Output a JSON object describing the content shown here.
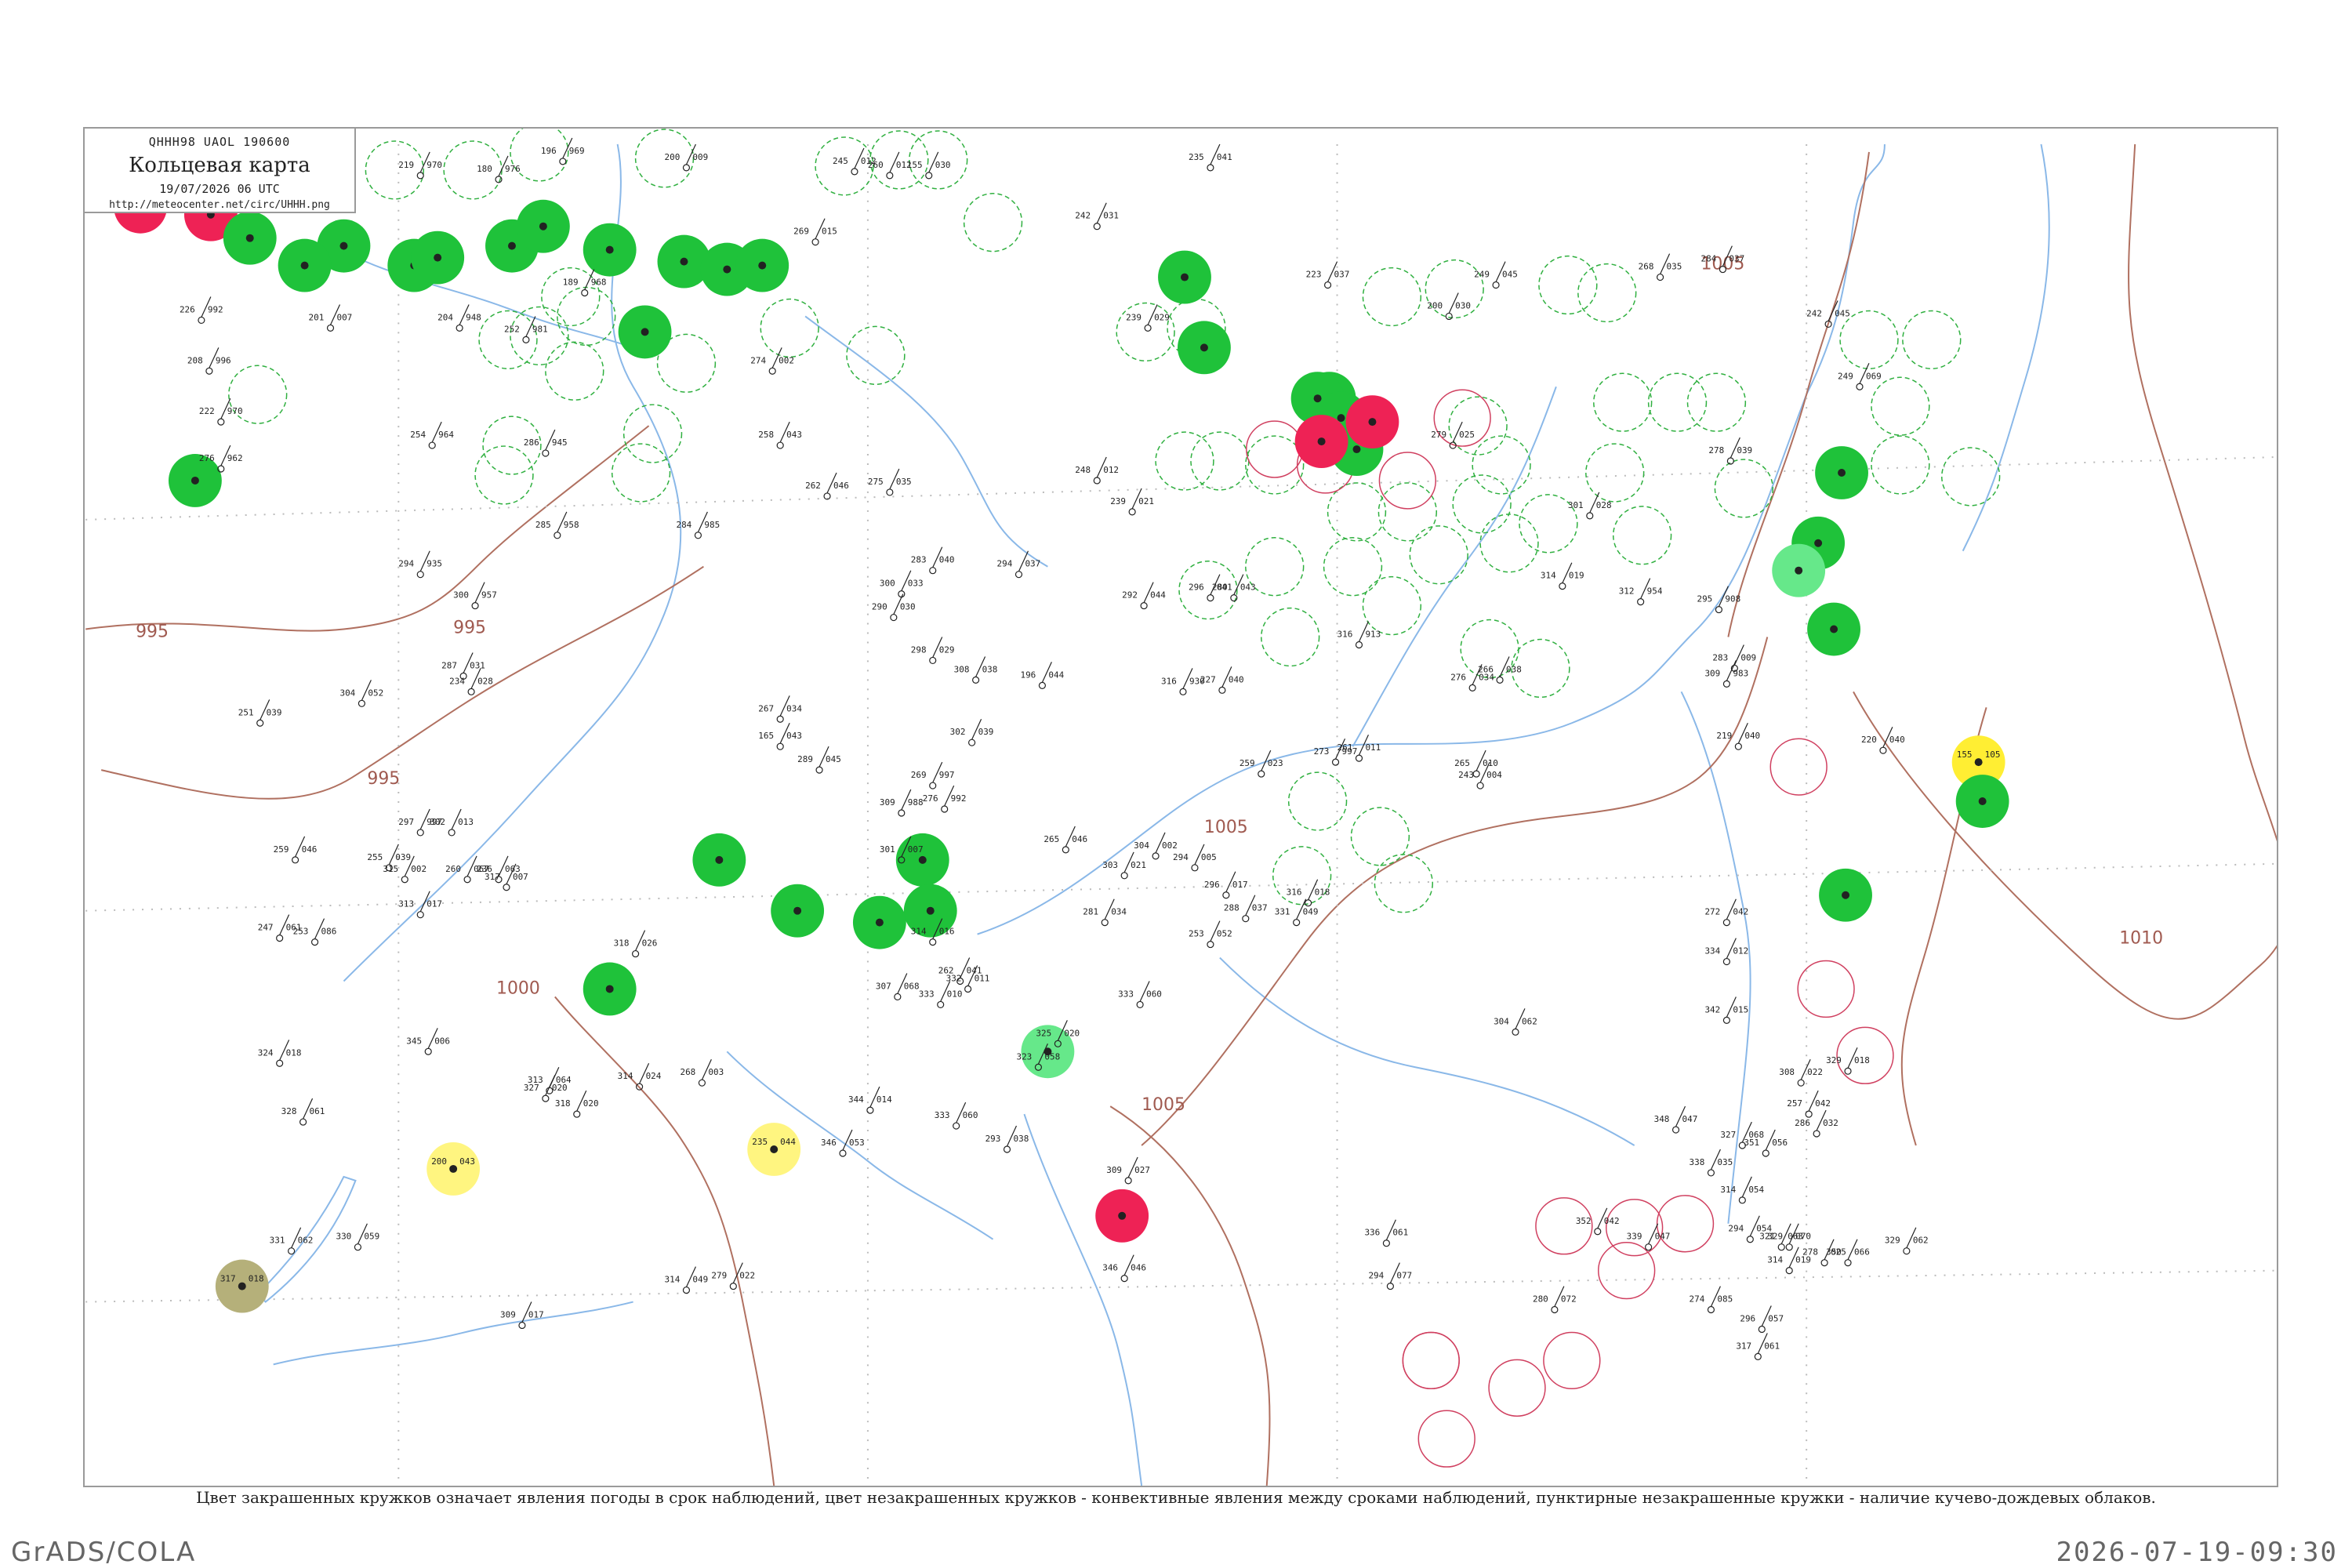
{
  "header": {
    "code": "QHHH98  UAOL  190600",
    "title": "Кольцевая карта",
    "datetime": "19/07/2026 06 UTC",
    "url": "http://meteocenter.net/circ/UHHH.png"
  },
  "caption": "Цвет закрашенных кружков означает явления погоды в срок наблюдений, цвет незакрашенных кружков - конвективные явления между сроками наблюдений, пунктирные незакрашенные кружки - наличие кучево-дождевых облаков.",
  "footer": {
    "left": "GrADS/COLA",
    "right": "2026-07-19-09:30"
  },
  "colors": {
    "isobar": "#b07060",
    "river": "#8ab8e8",
    "frame": "#9a9a9a",
    "rain": "#1fc23a",
    "rain_light": "#66e88a",
    "thunder": "#ee2255",
    "haze": "#ffee33",
    "haze_light": "#fff580",
    "fog": "#b5b07a",
    "cb_dashed": "#30b040",
    "convective_ring": "#d04060"
  },
  "isobars": [
    "995",
    "995",
    "995",
    "1000",
    "1005",
    "1005",
    "1005",
    "1010"
  ],
  "stations": [
    {
      "type": "thunder",
      "t": "",
      "p": ""
    },
    {
      "type": "thunder",
      "t": "",
      "p": ""
    },
    {
      "type": "rain",
      "t": "",
      "p": ""
    },
    {
      "type": "rain",
      "t": "",
      "p": ""
    },
    {
      "type": "rain",
      "t": "",
      "p": ""
    },
    {
      "type": "rain",
      "t": "",
      "p": ""
    },
    {
      "type": "rain",
      "t": "",
      "p": ""
    },
    {
      "type": "rain",
      "t": "",
      "p": ""
    },
    {
      "type": "rain",
      "t": "",
      "p": ""
    },
    {
      "type": "rain",
      "t": "",
      "p": ""
    },
    {
      "type": "rain",
      "t": "",
      "p": ""
    },
    {
      "type": "rain",
      "t": "",
      "p": ""
    },
    {
      "type": "rain",
      "t": "",
      "p": ""
    },
    {
      "type": "rain",
      "t": "",
      "p": ""
    },
    {
      "type": "rain",
      "t": "",
      "p": ""
    },
    {
      "type": "rain",
      "t": "",
      "p": ""
    },
    {
      "type": "rain",
      "t": "",
      "p": ""
    },
    {
      "type": "rain",
      "t": "",
      "p": ""
    },
    {
      "type": "rain",
      "t": "",
      "p": ""
    },
    {
      "type": "rain",
      "t": "",
      "p": ""
    },
    {
      "type": "thunder",
      "t": "",
      "p": ""
    },
    {
      "type": "rain",
      "t": "",
      "p": ""
    },
    {
      "type": "thunder",
      "t": "",
      "p": ""
    },
    {
      "type": "rain",
      "t": "",
      "p": ""
    },
    {
      "type": "rain",
      "t": "",
      "p": ""
    },
    {
      "type": "rain_light",
      "t": "",
      "p": ""
    },
    {
      "type": "rain",
      "t": "",
      "p": ""
    },
    {
      "type": "haze",
      "t": "155",
      "p": "105"
    },
    {
      "type": "rain",
      "t": "",
      "p": ""
    },
    {
      "type": "rain",
      "t": "",
      "p": ""
    },
    {
      "type": "rain_light",
      "t": "",
      "p": ""
    },
    {
      "type": "thunder",
      "t": "",
      "p": ""
    },
    {
      "type": "haze_light",
      "t": "200",
      "p": "043"
    },
    {
      "type": "haze_light",
      "t": "235",
      "p": "044"
    },
    {
      "type": "fog",
      "t": "317",
      "p": "018"
    },
    {
      "type": "rain",
      "t": "",
      "p": ""
    },
    {
      "type": "rain",
      "t": "",
      "p": ""
    },
    {
      "type": "rain",
      "t": "",
      "p": ""
    },
    {
      "type": "rain",
      "t": "",
      "p": ""
    },
    {
      "type": "rain",
      "t": "",
      "p": ""
    },
    {
      "type": "rain",
      "t": "",
      "p": ""
    }
  ],
  "obs": [
    {
      "t": "219",
      "p": "970"
    },
    {
      "t": "180",
      "p": "976"
    },
    {
      "t": "196",
      "p": "969"
    },
    {
      "t": "200",
      "p": "009"
    },
    {
      "t": "245",
      "p": "012"
    },
    {
      "t": "260",
      "p": "012"
    },
    {
      "t": "155",
      "p": "030"
    },
    {
      "t": "242",
      "p": "031"
    },
    {
      "t": "235",
      "p": "041"
    },
    {
      "t": "226",
      "p": "992"
    },
    {
      "t": "208",
      "p": "996"
    },
    {
      "t": "222",
      "p": "970"
    },
    {
      "t": "201",
      "p": "007"
    },
    {
      "t": "189",
      "p": "968"
    },
    {
      "t": "204",
      "p": "948"
    },
    {
      "t": "252",
      "p": "981"
    },
    {
      "t": "274",
      "p": "002"
    },
    {
      "t": "269",
      "p": "015"
    },
    {
      "t": "258",
      "p": "043"
    },
    {
      "t": "239",
      "p": "029"
    },
    {
      "t": "223",
      "p": "037"
    },
    {
      "t": "200",
      "p": "030"
    },
    {
      "t": "249",
      "p": "045"
    },
    {
      "t": "268",
      "p": "035"
    },
    {
      "t": "284",
      "p": "037"
    },
    {
      "t": "242",
      "p": "045"
    },
    {
      "t": "249",
      "p": "069"
    },
    {
      "t": "254",
      "p": "964"
    },
    {
      "t": "286",
      "p": "945"
    },
    {
      "t": "276",
      "p": "962"
    },
    {
      "t": "275",
      "p": "035"
    },
    {
      "t": "262",
      "p": "046"
    },
    {
      "t": "248",
      "p": "012"
    },
    {
      "t": "239",
      "p": "021"
    },
    {
      "t": "279",
      "p": "025"
    },
    {
      "t": "301",
      "p": "028"
    },
    {
      "t": "278",
      "p": "039"
    },
    {
      "t": "285",
      "p": "958"
    },
    {
      "t": "284",
      "p": "985"
    },
    {
      "t": "300",
      "p": "957"
    },
    {
      "t": "294",
      "p": "935"
    },
    {
      "t": "300",
      "p": "033"
    },
    {
      "t": "283",
      "p": "040"
    },
    {
      "t": "294",
      "p": "037"
    },
    {
      "t": "280",
      "p": "043"
    },
    {
      "t": "292",
      "p": "044"
    },
    {
      "t": "296",
      "p": "041"
    },
    {
      "t": "314",
      "p": "019"
    },
    {
      "t": "312",
      "p": "954"
    },
    {
      "t": "295",
      "p": "908"
    },
    {
      "t": "287",
      "p": "031"
    },
    {
      "t": "304",
      "p": "052"
    },
    {
      "t": "290",
      "p": "030"
    },
    {
      "t": "308",
      "p": "038"
    },
    {
      "t": "298",
      "p": "029"
    },
    {
      "t": "196",
      "p": "044"
    },
    {
      "t": "316",
      "p": "913"
    },
    {
      "t": "316",
      "p": "930"
    },
    {
      "t": "309",
      "p": "983"
    },
    {
      "t": "283",
      "p": "009"
    },
    {
      "t": "251",
      "p": "039"
    },
    {
      "t": "267",
      "p": "034"
    },
    {
      "t": "302",
      "p": "039"
    },
    {
      "t": "227",
      "p": "040"
    },
    {
      "t": "234",
      "p": "028"
    },
    {
      "t": "165",
      "p": "043"
    },
    {
      "t": "289",
      "p": "045"
    },
    {
      "t": "276",
      "p": "034"
    },
    {
      "t": "266",
      "p": "038"
    },
    {
      "t": "220",
      "p": "040"
    },
    {
      "t": "219",
      "p": "040"
    },
    {
      "t": "259",
      "p": "023"
    },
    {
      "t": "269",
      "p": "997"
    },
    {
      "t": "276",
      "p": "992"
    },
    {
      "t": "273",
      "p": "997"
    },
    {
      "t": "261",
      "p": "011"
    },
    {
      "t": "243",
      "p": "004"
    },
    {
      "t": "265",
      "p": "010"
    },
    {
      "t": "265",
      "p": "046"
    },
    {
      "t": "309",
      "p": "988"
    },
    {
      "t": "301",
      "p": "007"
    },
    {
      "t": "304",
      "p": "002"
    },
    {
      "t": "294",
      "p": "005"
    },
    {
      "t": "296",
      "p": "017"
    },
    {
      "t": "297",
      "p": "997"
    },
    {
      "t": "302",
      "p": "013"
    },
    {
      "t": "315",
      "p": "002"
    },
    {
      "t": "313",
      "p": "017"
    },
    {
      "t": "255",
      "p": "039"
    },
    {
      "t": "259",
      "p": "046"
    },
    {
      "t": "247",
      "p": "061"
    },
    {
      "t": "260",
      "p": "067"
    },
    {
      "t": "236",
      "p": "063"
    },
    {
      "t": "317",
      "p": "007"
    },
    {
      "t": "303",
      "p": "021"
    },
    {
      "t": "316",
      "p": "018"
    },
    {
      "t": "331",
      "p": "049"
    },
    {
      "t": "272",
      "p": "042"
    },
    {
      "t": "334",
      "p": "012"
    },
    {
      "t": "288",
      "p": "037"
    },
    {
      "t": "253",
      "p": "086"
    },
    {
      "t": "253",
      "p": "052"
    },
    {
      "t": "345",
      "p": "006"
    },
    {
      "t": "333",
      "p": "010"
    },
    {
      "t": "342",
      "p": "015"
    },
    {
      "t": "324",
      "p": "018"
    },
    {
      "t": "327",
      "p": "020"
    },
    {
      "t": "281",
      "p": "034"
    },
    {
      "t": "304",
      "p": "062"
    },
    {
      "t": "333",
      "p": "060"
    },
    {
      "t": "329",
      "p": "018"
    },
    {
      "t": "314",
      "p": "016"
    },
    {
      "t": "332",
      "p": "011"
    },
    {
      "t": "325",
      "p": "020"
    },
    {
      "t": "309",
      "p": "027"
    },
    {
      "t": "318",
      "p": "026"
    },
    {
      "t": "262",
      "p": "041"
    },
    {
      "t": "307",
      "p": "068"
    },
    {
      "t": "323",
      "p": "058"
    },
    {
      "t": "313",
      "p": "064"
    },
    {
      "t": "314",
      "p": "024"
    },
    {
      "t": "308",
      "p": "022"
    },
    {
      "t": "286",
      "p": "032"
    },
    {
      "t": "268",
      "p": "003"
    },
    {
      "t": "257",
      "p": "042"
    },
    {
      "t": "328",
      "p": "061"
    },
    {
      "t": "330",
      "p": "059"
    },
    {
      "t": "331",
      "p": "062"
    },
    {
      "t": "318",
      "p": "020"
    },
    {
      "t": "344",
      "p": "014"
    },
    {
      "t": "293",
      "p": "038"
    },
    {
      "t": "333",
      "p": "060"
    },
    {
      "t": "348",
      "p": "047"
    },
    {
      "t": "327",
      "p": "068"
    },
    {
      "t": "314",
      "p": "054"
    },
    {
      "t": "346",
      "p": "053"
    },
    {
      "t": "351",
      "p": "056"
    },
    {
      "t": "338",
      "p": "035"
    },
    {
      "t": "321",
      "p": "063"
    },
    {
      "t": "309",
      "p": "017"
    },
    {
      "t": "279",
      "p": "022"
    },
    {
      "t": "314",
      "p": "049"
    },
    {
      "t": "329",
      "p": "062"
    },
    {
      "t": "346",
      "p": "046"
    },
    {
      "t": "352",
      "p": "042"
    },
    {
      "t": "339",
      "p": "047"
    },
    {
      "t": "294",
      "p": "054"
    },
    {
      "t": "329",
      "p": "070"
    },
    {
      "t": "278",
      "p": "025"
    },
    {
      "t": "336",
      "p": "061"
    },
    {
      "t": "294",
      "p": "077"
    },
    {
      "t": "280",
      "p": "072"
    },
    {
      "t": "274",
      "p": "085"
    },
    {
      "t": "314",
      "p": "019"
    },
    {
      "t": "350",
      "p": "066"
    },
    {
      "t": "296",
      "p": "057"
    },
    {
      "t": "317",
      "p": "061"
    }
  ]
}
